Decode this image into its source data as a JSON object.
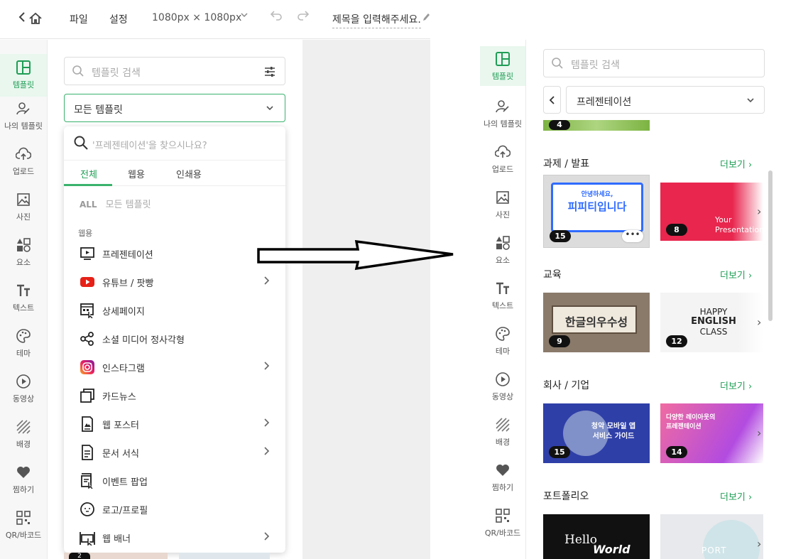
{
  "topbar": {
    "back_glyph": "<",
    "file": "파일",
    "settings": "설정",
    "size": "1080px × 1080px",
    "title_placeholder": "제목을 입력해주세요."
  },
  "sidebar": {
    "items": [
      {
        "label": "템플릿",
        "icon": "layout-icon"
      },
      {
        "label": "나의 템플릿",
        "icon": "my-template-icon"
      },
      {
        "label": "업로드",
        "icon": "upload-icon"
      },
      {
        "label": "사진",
        "icon": "photo-icon"
      },
      {
        "label": "요소",
        "icon": "elements-icon"
      },
      {
        "label": "텍스트",
        "icon": "text-icon"
      },
      {
        "label": "테마",
        "icon": "palette-icon"
      },
      {
        "label": "동영상",
        "icon": "video-icon"
      },
      {
        "label": "배경",
        "icon": "background-icon"
      },
      {
        "label": "찜하기",
        "icon": "heart-icon"
      },
      {
        "label": "QR/바코드",
        "icon": "qr-icon"
      }
    ]
  },
  "left": {
    "search_placeholder": "템플릿 검색",
    "select_value": "모든 템플릿",
    "dropdown": {
      "search_placeholder": "'프레젠테이션'을 찾으시나요?",
      "tabs": [
        "전체",
        "웹용",
        "인쇄용"
      ],
      "all_badge": "ALL",
      "all_label": "모든 템플릿",
      "section": "웹용",
      "items": [
        {
          "label": "프레젠테이션",
          "icon": "presentation-icon",
          "arrow": false
        },
        {
          "label": "유튜브 / 팟빵",
          "icon": "youtube-icon",
          "arrow": true
        },
        {
          "label": "상세페이지",
          "icon": "detail-page-icon",
          "arrow": false
        },
        {
          "label": "소셜 미디어 정사각형",
          "icon": "share-icon",
          "arrow": false
        },
        {
          "label": "인스타그램",
          "icon": "instagram-icon",
          "arrow": true
        },
        {
          "label": "카드뉴스",
          "icon": "card-news-icon",
          "arrow": false
        },
        {
          "label": "웹 포스터",
          "icon": "poster-icon",
          "arrow": true
        },
        {
          "label": "문서 서식",
          "icon": "document-icon",
          "arrow": true
        },
        {
          "label": "이벤트 팝업",
          "icon": "popup-icon",
          "arrow": false
        },
        {
          "label": "로고/프로필",
          "icon": "logo-icon",
          "arrow": false
        },
        {
          "label": "웹 배너",
          "icon": "banner-icon",
          "arrow": true
        }
      ]
    },
    "bottom_badge": "2"
  },
  "right": {
    "search_placeholder": "템플릿 검색",
    "select_value": "프레젠테이션",
    "top_badge": "4",
    "sections": [
      {
        "title": "과제 / 발표",
        "more": "더보기",
        "thumbs": [
          {
            "badge": "15",
            "text1": "안녕하세요,",
            "text2": "피피티입니다",
            "more": "•••"
          },
          {
            "badge": "8",
            "text1": "Your",
            "text2": "Presentation"
          }
        ]
      },
      {
        "title": "교육",
        "more": "더보기",
        "thumbs": [
          {
            "badge": "9",
            "text1": "한글의우수성"
          },
          {
            "badge": "12",
            "text1": "HAPPY",
            "text2": "ENGLISH",
            "text3": "CLASS"
          }
        ]
      },
      {
        "title": "회사 / 기업",
        "more": "더보기",
        "thumbs": [
          {
            "badge": "15",
            "text1": "청악 모바일 앱",
            "text2": "서비스 가이드"
          },
          {
            "badge": "14",
            "text1": "다양한 레이아웃의",
            "text2": "프레젠테이션"
          }
        ]
      },
      {
        "title": "포트폴리오",
        "more": "더보기",
        "thumbs": [
          {
            "text1": "Hello",
            "text2": "World"
          },
          {
            "text1": "PORT"
          }
        ]
      }
    ]
  },
  "colors": {
    "accent": "#1f9d55",
    "border_active": "#3ab36d",
    "active_bg": "#e9f7ee"
  }
}
